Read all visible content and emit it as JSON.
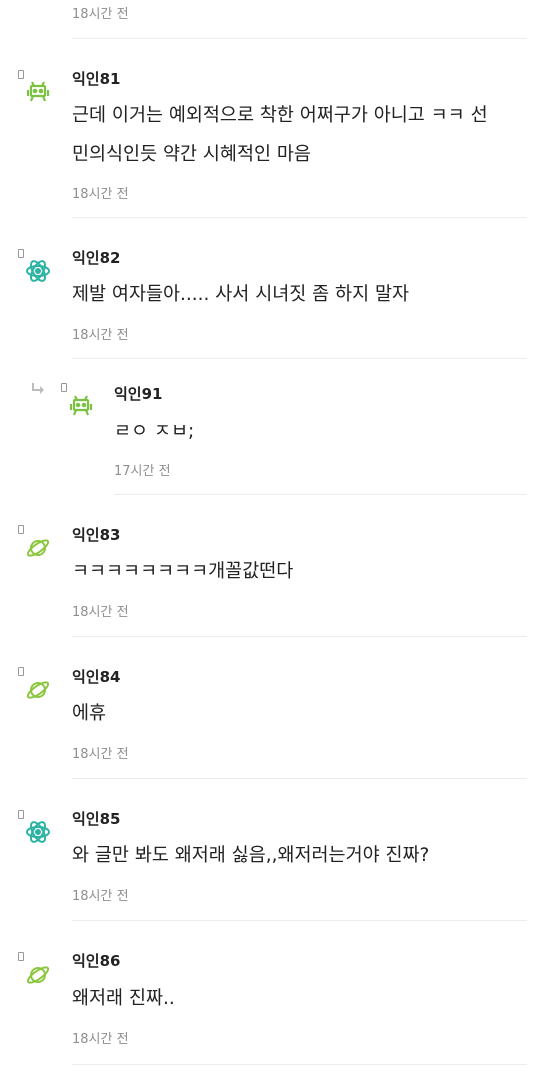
{
  "top": {
    "time": "18시간 전"
  },
  "comments": [
    {
      "author": "익인81",
      "lines": [
        "근데 이거는 예외적으로 착한 어쩌구가 아니고 ㅋㅋ 선",
        "민의식인듯 약간 시혜적인 마음"
      ],
      "time": "18시간 전",
      "icon": "invader-icon"
    },
    {
      "author": "익인82",
      "lines": [
        "제발 여자들아..... 사서 시녀짓 좀 하지 말자"
      ],
      "time": "18시간 전",
      "icon": "atom-icon"
    },
    {
      "author": "익인91",
      "lines": [
        "ㄹㅇ ㅈㅂ;"
      ],
      "time": "17시간 전",
      "icon": "invader-icon",
      "reply": true
    },
    {
      "author": "익인83",
      "lines": [
        "ㅋㅋㅋㅋㅋㅋㅋㅋ개꼴값떤다"
      ],
      "time": "18시간 전",
      "icon": "planet-icon"
    },
    {
      "author": "익인84",
      "lines": [
        "에휴"
      ],
      "time": "18시간 전",
      "icon": "planet-icon"
    },
    {
      "author": "익인85",
      "lines": [
        "와 글만 봐도 왜저래 싫음,,왜저러는거야 진짜?"
      ],
      "time": "18시간 전",
      "icon": "atom-icon"
    },
    {
      "author": "익인86",
      "lines": [
        "왜저래 진짜.."
      ],
      "time": "18시간 전",
      "icon": "planet-icon"
    }
  ],
  "colors": {
    "invader": "#7cc242",
    "atom": "#2bb3a3",
    "planet": "#8cc63f",
    "time": "#8f8f8f",
    "divider": "#ececec"
  }
}
